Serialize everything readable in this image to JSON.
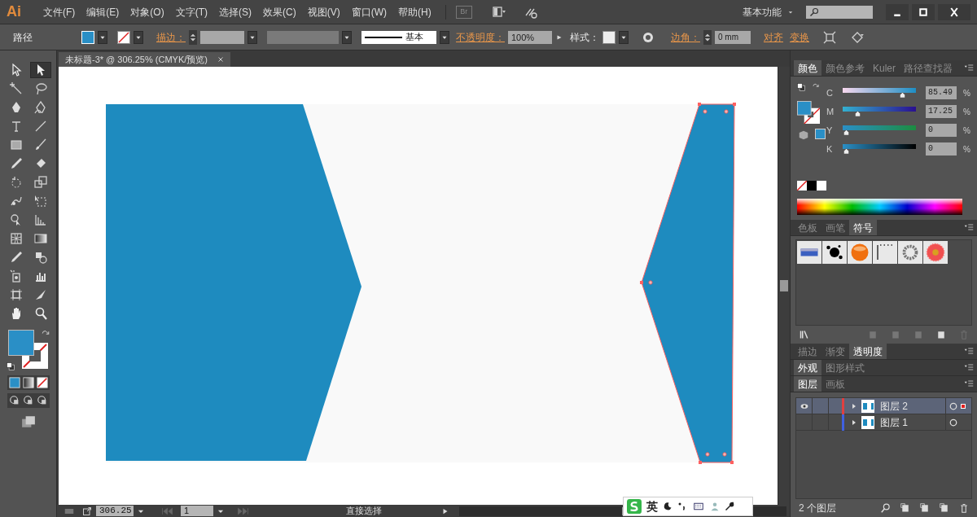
{
  "app_logo": "Ai",
  "menu": [
    "文件(F)",
    "编辑(E)",
    "对象(O)",
    "文字(T)",
    "选择(S)",
    "效果(C)",
    "视图(V)",
    "窗口(W)",
    "帮助(H)"
  ],
  "bridge_button": "Br",
  "workspace": "基本功能",
  "control_bar": {
    "object_type": "路径",
    "stroke_label": "描边：",
    "stroke_profile": "基本",
    "opacity_label": "不透明度：",
    "opacity": "100%",
    "style_label": "样式：",
    "corner_label": "边角：",
    "corner_value": "0 mm",
    "align": "对齐",
    "transform": "变换"
  },
  "document_tab": {
    "title": "未标题-3* @ 306.25% (CMYK/预览)"
  },
  "tools": [
    {
      "kind": "select",
      "selected": false
    },
    {
      "kind": "direct",
      "selected": true
    },
    {
      "kind": "wand",
      "selected": false
    },
    {
      "kind": "lasso",
      "selected": false
    },
    {
      "kind": "pen",
      "selected": false
    },
    {
      "kind": "curvature",
      "selected": false
    },
    {
      "kind": "type",
      "selected": false
    },
    {
      "kind": "line",
      "selected": false
    },
    {
      "kind": "rect",
      "selected": false
    },
    {
      "kind": "brush",
      "selected": false
    },
    {
      "kind": "pencil",
      "selected": false
    },
    {
      "kind": "eraser",
      "selected": false
    },
    {
      "kind": "rotate",
      "selected": false
    },
    {
      "kind": "scale",
      "selected": false
    },
    {
      "kind": "warp",
      "selected": false
    },
    {
      "kind": "freetransform",
      "selected": false
    },
    {
      "kind": "shapebuilder",
      "selected": false
    },
    {
      "kind": "perspective",
      "selected": false
    },
    {
      "kind": "mesh",
      "selected": false
    },
    {
      "kind": "gradient",
      "selected": false
    },
    {
      "kind": "eyedropper",
      "selected": false
    },
    {
      "kind": "blend",
      "selected": false
    },
    {
      "kind": "sprayer",
      "selected": false
    },
    {
      "kind": "graph",
      "selected": false
    },
    {
      "kind": "artboard",
      "selected": false
    },
    {
      "kind": "slice",
      "selected": false
    },
    {
      "kind": "hand",
      "selected": false
    },
    {
      "kind": "zoom",
      "selected": false
    }
  ],
  "color_panel": {
    "tabs": [
      {
        "label": "颜色",
        "selected": true
      },
      {
        "label": "颜色参考",
        "selected": false
      },
      {
        "label": "Kuler",
        "selected": false
      },
      {
        "label": "路径查找器",
        "selected": false
      }
    ],
    "sliders": [
      {
        "channel": "C",
        "level": 0.855,
        "value": "85.49",
        "unit": "%"
      },
      {
        "channel": "M",
        "level": 0.1725,
        "value": "17.25",
        "unit": "%"
      },
      {
        "channel": "Y",
        "level": 0,
        "value": "0",
        "unit": "%"
      },
      {
        "channel": "K",
        "level": 0,
        "value": "0",
        "unit": "%"
      }
    ]
  },
  "symbols_panel": {
    "tabs": [
      {
        "label": "色板",
        "selected": false
      },
      {
        "label": "画笔",
        "selected": false
      },
      {
        "label": "符号",
        "selected": true
      }
    ],
    "symbols": [
      {
        "kind": "banner"
      },
      {
        "kind": "splat"
      },
      {
        "kind": "ball"
      },
      {
        "kind": "frame"
      },
      {
        "kind": "ring"
      },
      {
        "kind": "flower"
      }
    ]
  },
  "stroke_group": {
    "tabs": [
      {
        "label": "描边",
        "selected": false
      },
      {
        "label": "渐变",
        "selected": false
      },
      {
        "label": "透明度",
        "selected": true
      }
    ]
  },
  "appearance_group": {
    "tabs": [
      {
        "label": "外观",
        "selected": true
      },
      {
        "label": "图形样式",
        "selected": false
      }
    ]
  },
  "layers_panel": {
    "tabs": [
      {
        "label": "图层",
        "selected": true
      },
      {
        "label": "画板",
        "selected": false
      }
    ],
    "layers": [
      {
        "name": "图层 2",
        "selected": true,
        "visible": true
      },
      {
        "name": "图层 1",
        "selected": false,
        "visible": false
      }
    ],
    "footer": "2 个图层"
  },
  "status_bar": {
    "zoom": "306.25",
    "artboard": "1",
    "tool": "直接选择"
  },
  "ime_bar": {
    "label": "英"
  }
}
